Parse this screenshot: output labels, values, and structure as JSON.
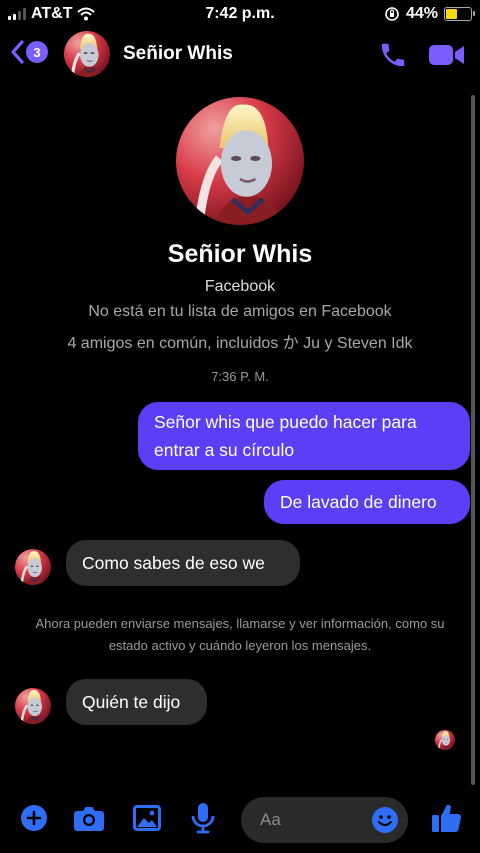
{
  "status_bar": {
    "carrier": "AT&T",
    "time": "7:42 p.m.",
    "battery": "44%",
    "battery_level": 0.44
  },
  "header": {
    "back_count": "3",
    "name": "Señior Whis"
  },
  "profile": {
    "name": "Señior Whis",
    "platform": "Facebook",
    "friend_status": "No está en tu lista de amigos en Facebook",
    "mutual": "4 amigos en común, incluidos か Ju y Steven Idk"
  },
  "timestamp": "7:36 P. M.",
  "messages": [
    {
      "from": "me",
      "text": "Señor whis que puedo hacer para entrar a su círculo"
    },
    {
      "from": "me",
      "text": "De lavado de dinero"
    },
    {
      "from": "them",
      "text": "Como sabes de eso we"
    },
    {
      "from": "them",
      "text": "Quién te dijo"
    }
  ],
  "notice": "Ahora pueden enviarse mensajes, llamarse y ver información, como su estado activo y cuándo leyeron los mensajes.",
  "composer": {
    "placeholder": "Aa"
  },
  "colors": {
    "accent": "#7a5cff",
    "bubble_out": "#5b3ef5",
    "bubble_in": "#2e2e2e",
    "background": "#000000"
  }
}
